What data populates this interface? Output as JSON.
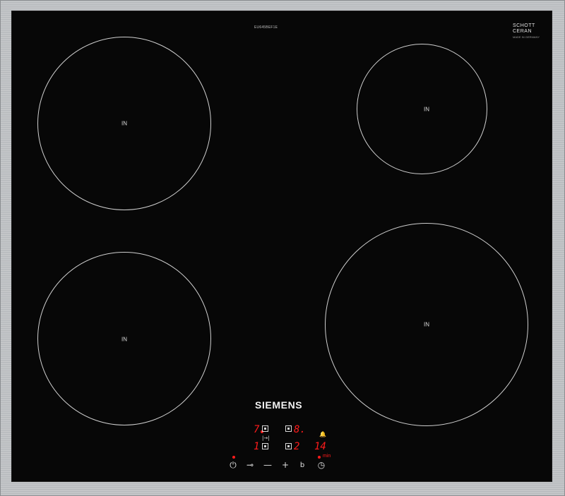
{
  "device": {
    "model_code": "EU645BEF1E",
    "glass_brand": "SCHOTT CERAN",
    "glass_sub": "MADE IN GERMANY",
    "brand": "SIEMENS"
  },
  "zones": [
    {
      "label": "IN"
    },
    {
      "label": "IN"
    },
    {
      "label": "IN"
    },
    {
      "label": "IN"
    }
  ],
  "display": {
    "top_left_level": "7",
    "top_right_level": "8.",
    "bottom_left_level": "1",
    "bottom_right_level": "2",
    "timer_value": "14",
    "timer_unit": "min",
    "boost_symbol": "|→|"
  },
  "controls": {
    "power": "⏻",
    "childlock": "⊸",
    "minus": "—",
    "plus": "+",
    "boost": "b",
    "timer": "◷",
    "alarm": "🔔"
  },
  "colors": {
    "glass": "#070707",
    "frame": "#c4c6c8",
    "indicator": "#ff1b1b",
    "zone_outline": "#cfcfcf"
  }
}
